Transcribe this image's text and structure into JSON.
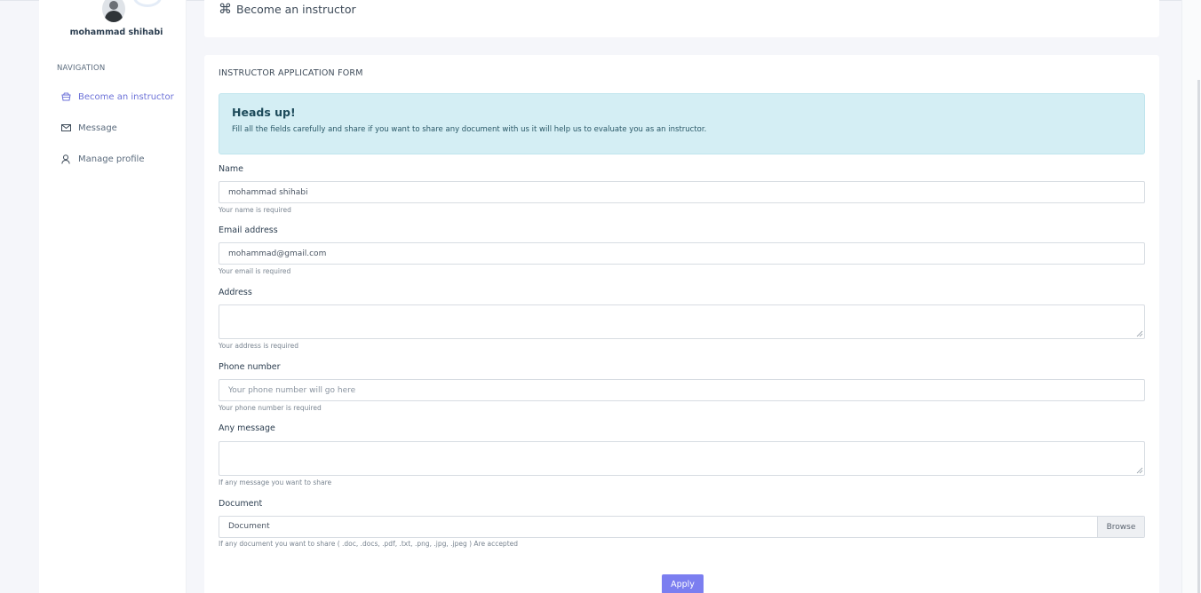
{
  "user": {
    "name": "mohammad shihabi"
  },
  "navigation": {
    "title": "NAVIGATION",
    "items": [
      {
        "label": "Become an instructor",
        "icon": "basket-icon",
        "active": true
      },
      {
        "label": "Message",
        "icon": "envelope-icon",
        "active": false
      },
      {
        "label": "Manage profile",
        "icon": "user-icon",
        "active": false
      }
    ]
  },
  "header": {
    "icon": "command-icon",
    "title": "Become an instructor"
  },
  "form": {
    "title": "INSTRUCTOR APPLICATION FORM",
    "alert": {
      "heading": "Heads up!",
      "text": "Fill all the fields carefully and share if you want to share any document with us it will help us to evaluate you as an instructor."
    },
    "name": {
      "label": "Name",
      "value": "mohammad shihabi",
      "help": "Your name is required"
    },
    "email": {
      "label": "Email address",
      "value": "mohammad@gmail.com",
      "help": "Your email is required"
    },
    "address": {
      "label": "Address",
      "value": "",
      "help": "Your address is required"
    },
    "phone": {
      "label": "Phone number",
      "placeholder": "Your phone number will go here",
      "help": "Your phone number is required"
    },
    "message": {
      "label": "Any message",
      "value": "",
      "help": "If any message you want to share"
    },
    "document": {
      "label": "Document",
      "placeholder": "Document",
      "browse_label": "Browse",
      "help": "If any document you want to share ( .doc, .docs, .pdf, .txt, .png, .jpg, .jpeg ) Are accepted"
    },
    "submit_label": "Apply"
  },
  "colors": {
    "accent": "#7b7ef0",
    "active_nav": "#6c72d8",
    "alert_bg": "#d4eef4"
  }
}
